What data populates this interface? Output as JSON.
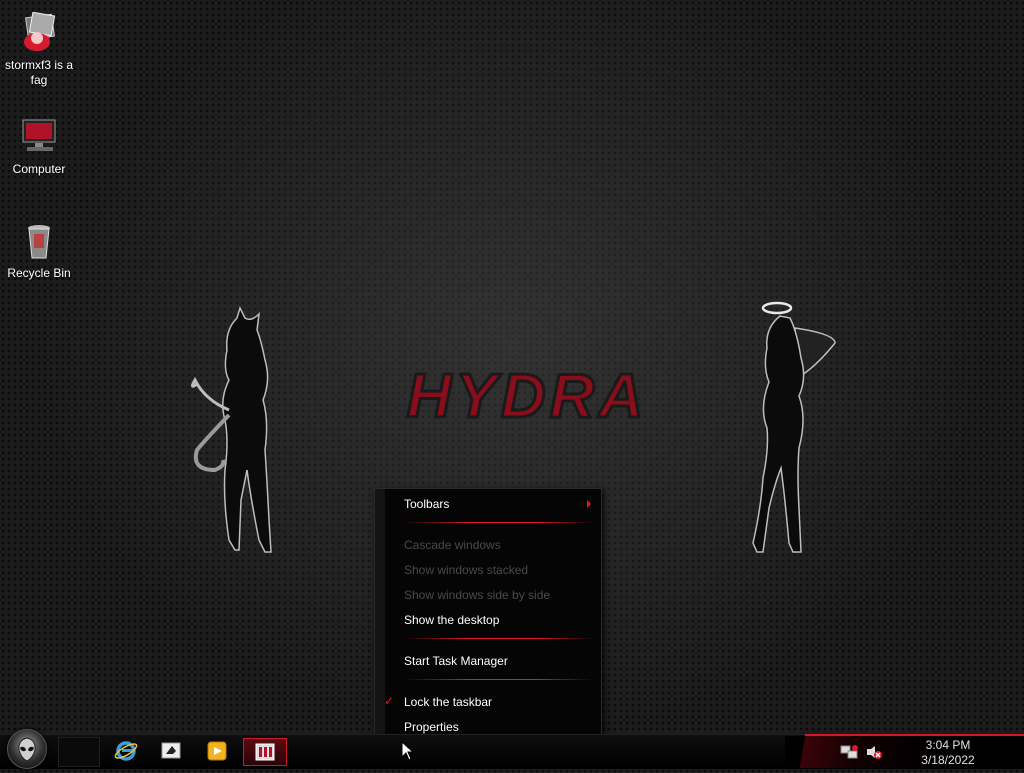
{
  "desktop": {
    "icons": [
      {
        "label": "stormxf3 is a fag",
        "icon": "user-folder-icon"
      },
      {
        "label": "Computer",
        "icon": "computer-icon"
      },
      {
        "label": "Recycle Bin",
        "icon": "recycle-bin-icon"
      }
    ],
    "wallpaper_text": "HYDRA"
  },
  "context_menu": {
    "items": [
      {
        "label": "Toolbars",
        "enabled": true,
        "submenu": true
      },
      {
        "label": "Cascade windows",
        "enabled": false
      },
      {
        "label": "Show windows stacked",
        "enabled": false
      },
      {
        "label": "Show windows side by side",
        "enabled": false
      },
      {
        "label": "Show the desktop",
        "enabled": true
      },
      {
        "label": "Start Task Manager",
        "enabled": true
      },
      {
        "label": "Lock the taskbar",
        "enabled": true,
        "checked": true
      },
      {
        "label": "Properties",
        "enabled": true
      }
    ],
    "check_glyph": "✓"
  },
  "taskbar": {
    "start_button": "alien-orb-icon",
    "pinned": [
      "internet-explorer-icon",
      "windows-explorer-icon",
      "media-player-icon",
      "app-window-icon"
    ],
    "tray": {
      "icons": [
        "network-icon",
        "volume-muted-icon"
      ],
      "time": "3:04 PM",
      "date": "3/18/2022"
    }
  },
  "colors": {
    "accent": "#e8162e",
    "menu_bg": "#050505",
    "disabled_text": "#4a4a4a"
  }
}
